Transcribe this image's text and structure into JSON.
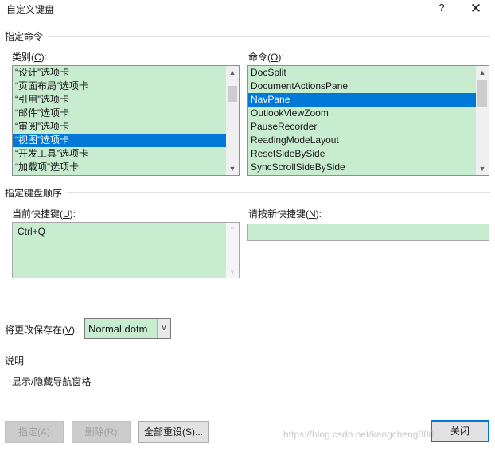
{
  "window": {
    "title": "自定义键盘",
    "help": "?",
    "close_glyph": "✕"
  },
  "assign_section": {
    "title": "指定命令"
  },
  "categories": {
    "label": "类别(C):",
    "label_pre": "类别(",
    "label_key": "C",
    "label_post": "):",
    "items": [
      "“设计”选项卡",
      "“页面布局”选项卡",
      "“引用”选项卡",
      "“邮件”选项卡",
      "“审阅”选项卡",
      "“视图”选项卡",
      "“开发工具”选项卡",
      "“加载项”选项卡"
    ],
    "selected_index": 5
  },
  "commands": {
    "label_pre": "命令(",
    "label_key": "O",
    "label_post": "):",
    "items": [
      "DocSplit",
      "DocumentActionsPane",
      "NavPane",
      "OutlookViewZoom",
      "PauseRecorder",
      "ReadingModeLayout",
      "ResetSideBySide",
      "SyncScrollSideBySide"
    ],
    "selected_index": 2
  },
  "shortcut_section": {
    "title": "指定键盘顺序"
  },
  "current_keys": {
    "label_pre": "当前快捷键(",
    "label_key": "U",
    "label_post": "):",
    "items": [
      "Ctrl+Q"
    ]
  },
  "new_key": {
    "label_pre": "请按新快捷键(",
    "label_key": "N",
    "label_post": "):",
    "value": ""
  },
  "save_in": {
    "label_pre": "将更改保存在(",
    "label_key": "V",
    "label_post": "):",
    "value": "Normal.dotm"
  },
  "description": {
    "title": "说明",
    "text": "显示/隐藏导航窗格"
  },
  "buttons": {
    "assign": "指定(A)",
    "remove": "删除(R)",
    "reset_all": "全部重设(S)...",
    "close": "关闭"
  },
  "watermark": "https://blog.csdn.net/kangcheng888",
  "colors": {
    "field_bg": "#c8ecd0",
    "selection": "#0078d7"
  }
}
